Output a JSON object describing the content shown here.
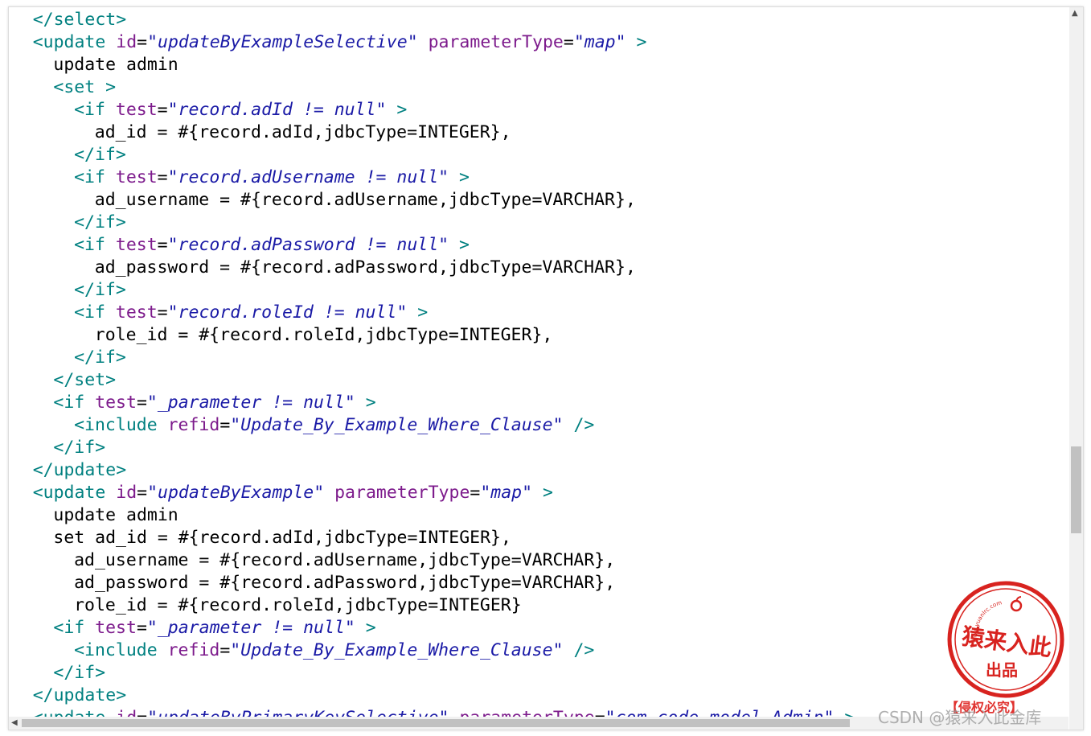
{
  "code_lines": [
    {
      "indent": 1,
      "tokens": [
        {
          "c": "tg",
          "t": "</select>"
        }
      ]
    },
    {
      "indent": 1,
      "tokens": [
        {
          "c": "tg",
          "t": "<update "
        },
        {
          "c": "at",
          "t": "id"
        },
        {
          "c": "tx",
          "t": "="
        },
        {
          "c": "vl",
          "t": "\"updateByExampleSelective\""
        },
        {
          "c": "tx",
          "t": " "
        },
        {
          "c": "at",
          "t": "parameterType"
        },
        {
          "c": "tx",
          "t": "="
        },
        {
          "c": "vl",
          "t": "\"map\""
        },
        {
          "c": "tg",
          "t": " >"
        }
      ]
    },
    {
      "indent": 2,
      "tokens": [
        {
          "c": "tx",
          "t": "update admin"
        }
      ]
    },
    {
      "indent": 2,
      "tokens": [
        {
          "c": "tg",
          "t": "<set >"
        }
      ]
    },
    {
      "indent": 3,
      "tokens": [
        {
          "c": "tg",
          "t": "<if "
        },
        {
          "c": "at",
          "t": "test"
        },
        {
          "c": "tx",
          "t": "="
        },
        {
          "c": "vl",
          "t": "\"record.adId != null\""
        },
        {
          "c": "tg",
          "t": " >"
        }
      ]
    },
    {
      "indent": 4,
      "tokens": [
        {
          "c": "tx",
          "t": "ad_id = #{record.adId,jdbcType=INTEGER},"
        }
      ]
    },
    {
      "indent": 3,
      "tokens": [
        {
          "c": "tg",
          "t": "</if>"
        }
      ]
    },
    {
      "indent": 3,
      "tokens": [
        {
          "c": "tg",
          "t": "<if "
        },
        {
          "c": "at",
          "t": "test"
        },
        {
          "c": "tx",
          "t": "="
        },
        {
          "c": "vl",
          "t": "\"record.adUsername != null\""
        },
        {
          "c": "tg",
          "t": " >"
        }
      ]
    },
    {
      "indent": 4,
      "tokens": [
        {
          "c": "tx",
          "t": "ad_username = #{record.adUsername,jdbcType=VARCHAR},"
        }
      ]
    },
    {
      "indent": 3,
      "tokens": [
        {
          "c": "tg",
          "t": "</if>"
        }
      ]
    },
    {
      "indent": 3,
      "tokens": [
        {
          "c": "tg",
          "t": "<if "
        },
        {
          "c": "at",
          "t": "test"
        },
        {
          "c": "tx",
          "t": "="
        },
        {
          "c": "vl",
          "t": "\"record.adPassword != null\""
        },
        {
          "c": "tg",
          "t": " >"
        }
      ]
    },
    {
      "indent": 4,
      "tokens": [
        {
          "c": "tx",
          "t": "ad_password = #{record.adPassword,jdbcType=VARCHAR},"
        }
      ]
    },
    {
      "indent": 3,
      "tokens": [
        {
          "c": "tg",
          "t": "</if>"
        }
      ]
    },
    {
      "indent": 3,
      "tokens": [
        {
          "c": "tg",
          "t": "<if "
        },
        {
          "c": "at",
          "t": "test"
        },
        {
          "c": "tx",
          "t": "="
        },
        {
          "c": "vl",
          "t": "\"record.roleId != null\""
        },
        {
          "c": "tg",
          "t": " >"
        }
      ]
    },
    {
      "indent": 4,
      "tokens": [
        {
          "c": "tx",
          "t": "role_id = #{record.roleId,jdbcType=INTEGER},"
        }
      ]
    },
    {
      "indent": 3,
      "tokens": [
        {
          "c": "tg",
          "t": "</if>"
        }
      ]
    },
    {
      "indent": 2,
      "tokens": [
        {
          "c": "tg",
          "t": "</set>"
        }
      ]
    },
    {
      "indent": 2,
      "tokens": [
        {
          "c": "tg",
          "t": "<if "
        },
        {
          "c": "at",
          "t": "test"
        },
        {
          "c": "tx",
          "t": "="
        },
        {
          "c": "vl",
          "t": "\"_parameter != null\""
        },
        {
          "c": "tg",
          "t": " >"
        }
      ]
    },
    {
      "indent": 3,
      "tokens": [
        {
          "c": "tg",
          "t": "<include "
        },
        {
          "c": "at",
          "t": "refid"
        },
        {
          "c": "tx",
          "t": "="
        },
        {
          "c": "vl",
          "t": "\"Update_By_Example_Where_Clause\""
        },
        {
          "c": "tg",
          "t": " />"
        }
      ]
    },
    {
      "indent": 2,
      "tokens": [
        {
          "c": "tg",
          "t": "</if>"
        }
      ]
    },
    {
      "indent": 1,
      "tokens": [
        {
          "c": "tg",
          "t": "</update>"
        }
      ]
    },
    {
      "indent": 1,
      "tokens": [
        {
          "c": "tg",
          "t": "<update "
        },
        {
          "c": "at",
          "t": "id"
        },
        {
          "c": "tx",
          "t": "="
        },
        {
          "c": "vl",
          "t": "\"updateByExample\""
        },
        {
          "c": "tx",
          "t": " "
        },
        {
          "c": "at",
          "t": "parameterType"
        },
        {
          "c": "tx",
          "t": "="
        },
        {
          "c": "vl",
          "t": "\"map\""
        },
        {
          "c": "tg",
          "t": " >"
        }
      ]
    },
    {
      "indent": 2,
      "tokens": [
        {
          "c": "tx",
          "t": "update admin"
        }
      ]
    },
    {
      "indent": 2,
      "tokens": [
        {
          "c": "tx",
          "t": "set ad_id = #{record.adId,jdbcType=INTEGER},"
        }
      ]
    },
    {
      "indent": 3,
      "tokens": [
        {
          "c": "tx",
          "t": "ad_username = #{record.adUsername,jdbcType=VARCHAR},"
        }
      ]
    },
    {
      "indent": 3,
      "tokens": [
        {
          "c": "tx",
          "t": "ad_password = #{record.adPassword,jdbcType=VARCHAR},"
        }
      ]
    },
    {
      "indent": 3,
      "tokens": [
        {
          "c": "tx",
          "t": "role_id = #{record.roleId,jdbcType=INTEGER}"
        }
      ]
    },
    {
      "indent": 2,
      "tokens": [
        {
          "c": "tg",
          "t": "<if "
        },
        {
          "c": "at",
          "t": "test"
        },
        {
          "c": "tx",
          "t": "="
        },
        {
          "c": "vl",
          "t": "\"_parameter != null\""
        },
        {
          "c": "tg",
          "t": " >"
        }
      ]
    },
    {
      "indent": 3,
      "tokens": [
        {
          "c": "tg",
          "t": "<include "
        },
        {
          "c": "at",
          "t": "refid"
        },
        {
          "c": "tx",
          "t": "="
        },
        {
          "c": "vl",
          "t": "\"Update_By_Example_Where_Clause\""
        },
        {
          "c": "tg",
          "t": " />"
        }
      ]
    },
    {
      "indent": 2,
      "tokens": [
        {
          "c": "tg",
          "t": "</if>"
        }
      ]
    },
    {
      "indent": 1,
      "tokens": [
        {
          "c": "tg",
          "t": "</update>"
        }
      ]
    },
    {
      "indent": 1,
      "tokens": [
        {
          "c": "tg",
          "t": "<update "
        },
        {
          "c": "at",
          "t": "id"
        },
        {
          "c": "tx",
          "t": "="
        },
        {
          "c": "vl",
          "t": "\"updateByPrimaryKeySelective\""
        },
        {
          "c": "tx",
          "t": " "
        },
        {
          "c": "at",
          "t": "parameterType"
        },
        {
          "c": "tx",
          "t": "="
        },
        {
          "c": "vl",
          "t": "\"com.code.model.Admin\""
        },
        {
          "c": "tg",
          "t": " >"
        }
      ]
    }
  ],
  "colors": {
    "tag": "#008080",
    "attr": "#7d1b8c",
    "value": "#1a1aa6",
    "text": "#000000"
  },
  "watermark": {
    "stamp_url": "www.yuanlrc.com",
    "stamp_main": "猿来入此",
    "stamp_sub": "出品",
    "footer_text": "【侵权必究】",
    "csdn_text": "CSDN @猿来入此金库"
  },
  "icons": [
    "scroll-up-arrow-icon",
    "scroll-down-arrow-icon",
    "scroll-left-arrow-icon",
    "scroll-right-arrow-icon",
    "apple-icon"
  ]
}
